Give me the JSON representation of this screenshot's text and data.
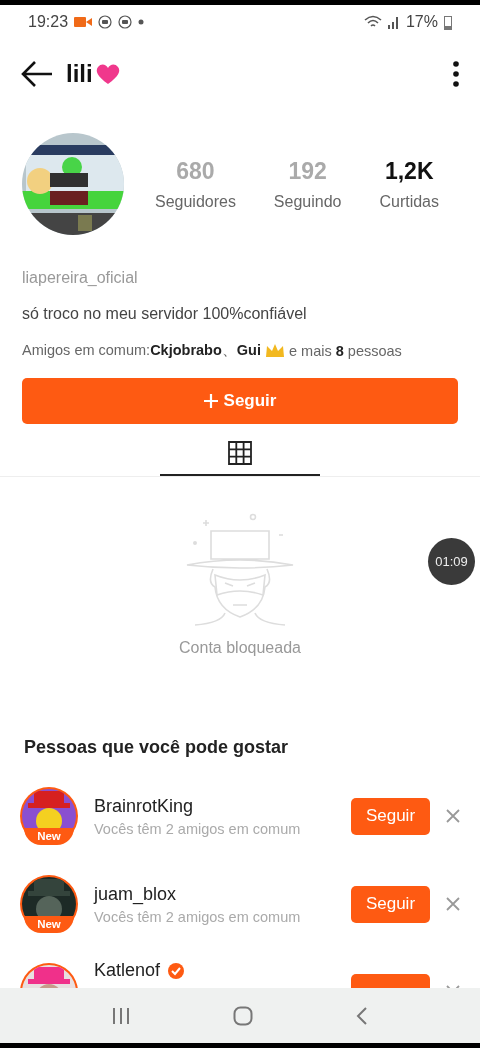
{
  "status_bar": {
    "time": "19:23",
    "battery": "17%"
  },
  "header": {
    "title": "lili"
  },
  "profile": {
    "stats": [
      {
        "value": "680",
        "label": "Seguidores",
        "muted": true
      },
      {
        "value": "192",
        "label": "Seguindo",
        "muted": true
      },
      {
        "value": "1,2K",
        "label": "Curtidas",
        "muted": false
      }
    ],
    "username": "liapereira_oficial",
    "bio": "só troco no meu servidor 100%confiável",
    "mutual_before": "Amigos em comum:**Ckjobrabo**、**Gui**",
    "mutual_after": "e mais **8** pessoas",
    "follow_button": "Seguir"
  },
  "tabs": [
    {
      "kind": "grid",
      "selected": true
    }
  ],
  "timer": "01:09",
  "empty_state": {
    "message": "Conta bloqueada"
  },
  "suggestions": {
    "title": "Pessoas que você pode gostar",
    "items": [
      {
        "name": "BrainrotKing",
        "subtitle": "Vocês têm 2 amigos em comum",
        "badge": "New",
        "verified": false,
        "button": "Seguir"
      },
      {
        "name": "juam_blox",
        "subtitle": "Vocês têm 2 amigos em comum",
        "badge": "New",
        "verified": false,
        "button": "Seguir"
      },
      {
        "name": "Katlenof",
        "verified": true
      }
    ]
  }
}
